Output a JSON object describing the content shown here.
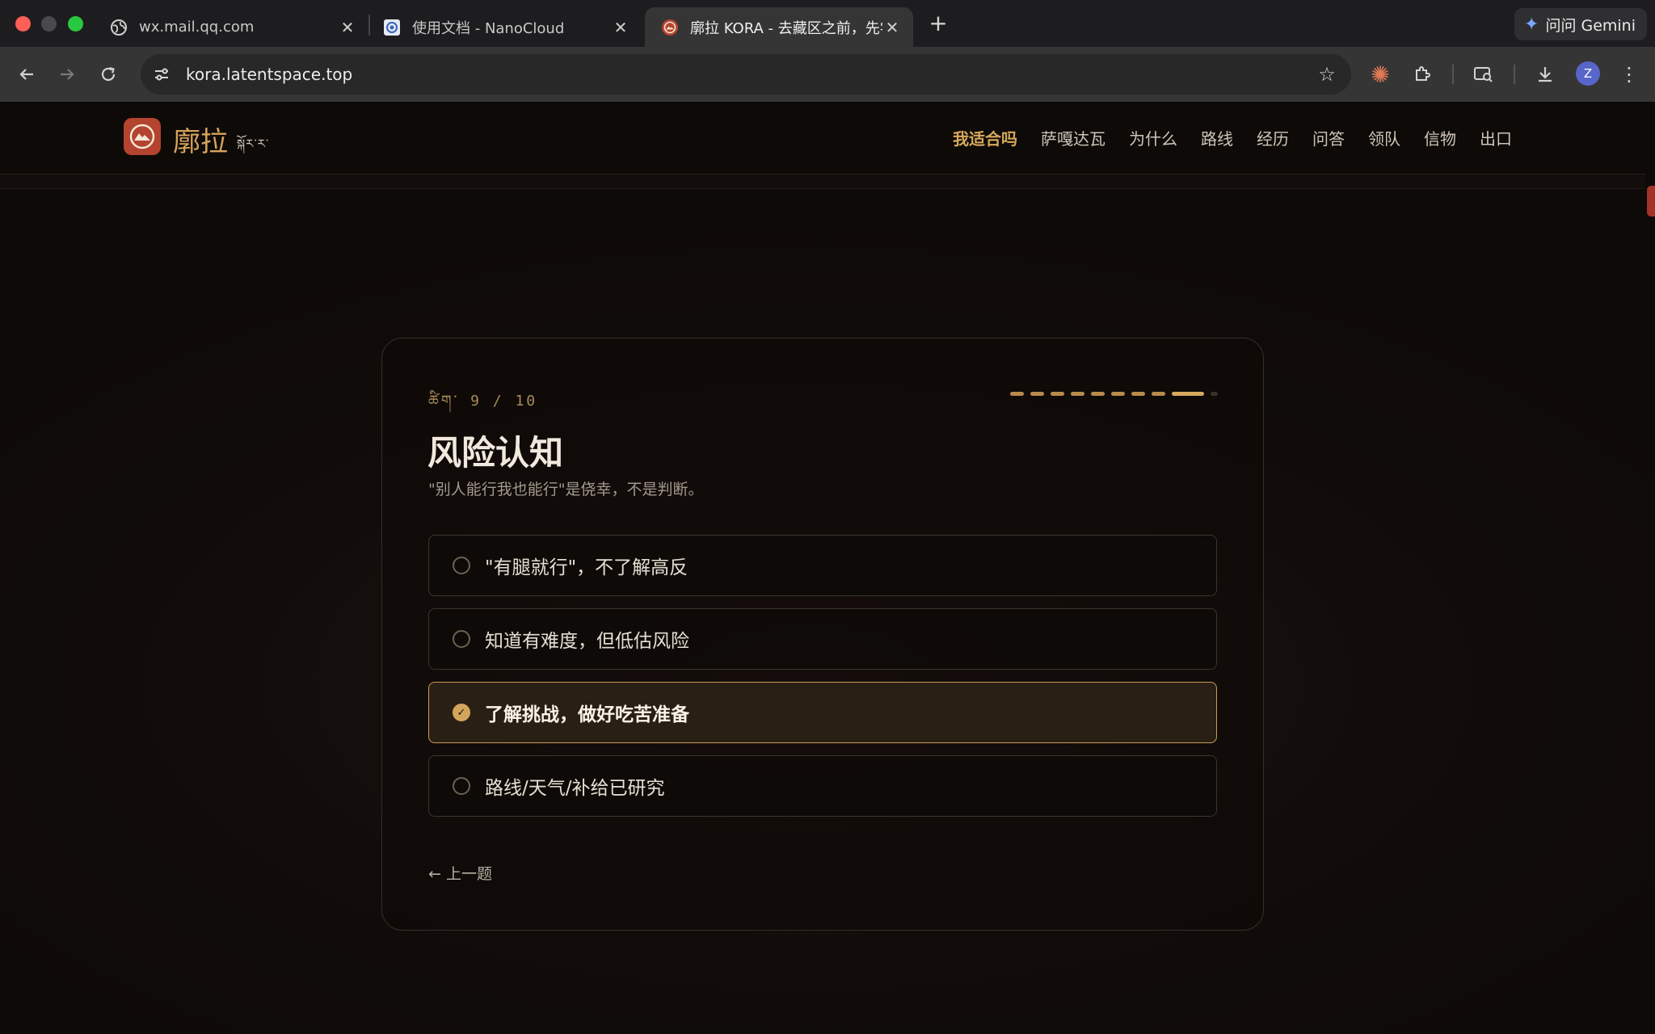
{
  "browser": {
    "tabs": [
      {
        "title": "wx.mail.qq.com",
        "favicon": "globe-icon"
      },
      {
        "title": "使用文档 - NanoCloud",
        "favicon": "nanocloud-icon"
      },
      {
        "title": "廓拉 KORA - 去藏区之前，先学",
        "favicon": "kora-icon",
        "active": true
      }
    ],
    "new_tab": "+",
    "gemini_label": "问问 Gemini",
    "url": "kora.latentspace.top",
    "profile_initial": "Z"
  },
  "site": {
    "logo_text": "廓拉",
    "logo_tibetan": "སྐོར་ར་",
    "nav": [
      "我适合吗",
      "萨嘎达瓦",
      "为什么",
      "路线",
      "经历",
      "问答",
      "领队",
      "信物",
      "出口"
    ],
    "nav_active_index": 0
  },
  "quiz": {
    "step_label": "ཚིག་ 9 / 10",
    "current": 9,
    "total": 10,
    "title": "风险认知",
    "subtitle": "\"别人能行我也能行\"是侥幸，不是判断。",
    "options": [
      "\"有腿就行\"，不了解高反",
      "知道有难度，但低估风险",
      "了解挑战，做好吃苦准备",
      "路线/天气/补给已研究"
    ],
    "selected_index": 2,
    "prev_label": "← 上一题"
  },
  "colors": {
    "accent": "#d7a95c",
    "logo_red": "#b4432f",
    "background": "#0f0b09"
  }
}
